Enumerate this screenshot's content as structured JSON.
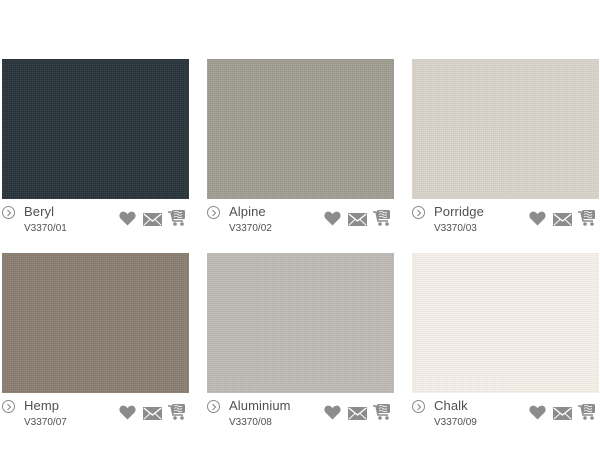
{
  "swatches": [
    {
      "name": "Beryl",
      "code": "V3370/01",
      "color": "#28343b"
    },
    {
      "name": "Alpine",
      "code": "V3370/02",
      "color": "#a19f92"
    },
    {
      "name": "Porridge",
      "code": "V3370/03",
      "color": "#dbd5cc"
    },
    {
      "name": "Hemp",
      "code": "V3370/07",
      "color": "#8b7e72"
    },
    {
      "name": "Aluminium",
      "code": "V3370/08",
      "color": "#bfbcb8"
    },
    {
      "name": "Chalk",
      "code": "V3370/09",
      "color": "#f7f2eb"
    }
  ],
  "icons": {
    "info": "chevron-right-icon",
    "favourite": "heart-icon",
    "email": "mail-icon",
    "sample": "fabric-sample-cart-icon"
  },
  "colors": {
    "text": "#505050",
    "icon": "#8c8c8c"
  }
}
